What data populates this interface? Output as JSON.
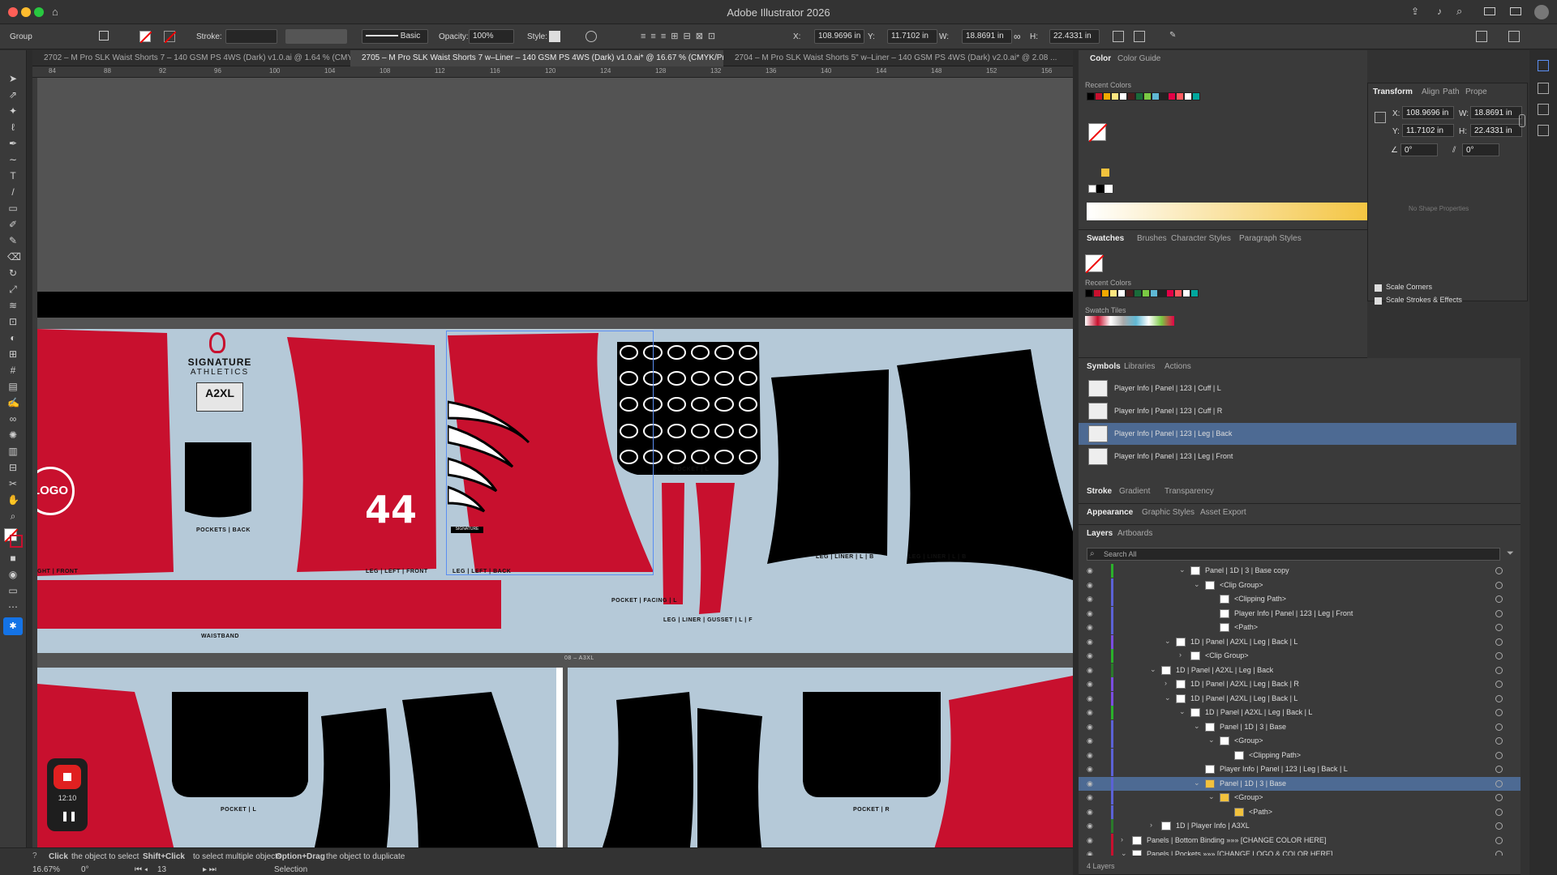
{
  "window": {
    "title": "Adobe Illustrator 2026"
  },
  "control": {
    "selection_type": "Group",
    "stroke_label": "Stroke:",
    "stroke_style": "Basic",
    "opacity_label": "Opacity:",
    "opacity_value": "100%",
    "style_label": "Style:",
    "x_label": "X:",
    "x_value": "108.9696 in",
    "y_label": "Y:",
    "y_value": "11.7102 in",
    "w_label": "W:",
    "w_value": "18.8691 in",
    "h_label": "H:",
    "h_value": "22.4331 in"
  },
  "tabs": [
    "2702 – M Pro SLK Waist Shorts 7 – 140 GSM PS 4WS (Dark) v1.0.ai @ 1.64 % (CMYK/P...",
    "2705 – M Pro SLK Waist Shorts 7 w–Liner – 140 GSM PS 4WS (Dark) v1.0.ai* @ 16.67 % (CMYK/Preview)",
    "2704 – M Pro SLK Waist Shorts 5\" w–Liner – 140 GSM PS 4WS (Dark) v2.0.ai* @ 2.08 ..."
  ],
  "ruler_ticks": [
    "84",
    "88",
    "92",
    "96",
    "100",
    "104",
    "108",
    "112",
    "116",
    "120",
    "124",
    "128",
    "132",
    "136",
    "140",
    "144",
    "148",
    "152",
    "156"
  ],
  "artwork": {
    "brand_top": "SIGNATURE",
    "brand_bottom": "ATHLETICS",
    "size_label": "A2XL",
    "logo_text": "LOGO",
    "player_number": "44",
    "signature_tag": "SIGNATURE",
    "labels": {
      "right_front": "GHT | FRONT",
      "pockets_back": "POCKETS | BACK",
      "leg_left_front": "LEG | LEFT | FRONT",
      "leg_left_back": "LEG | LEFT | BACK",
      "pocket_l": "POCKET | L",
      "pocket_facing": "POCKET | FACING | L",
      "liner_gusset": "LEG | LINER | GUSSET | L | F",
      "liner_l_b": "LEG | LINER | L | B",
      "liner_l_b2": "LEG | LINER | L | B",
      "waistband": "WAISTBAND",
      "pocket_l2": "POCKET | L",
      "pocket_r": "POCKET | R",
      "artboard_name": "08 – A3XL"
    }
  },
  "status": {
    "hint_click": "Click",
    "hint_click_text": "the object to select",
    "hint_shift": "Shift+Click",
    "hint_shift_text": "to select multiple objects",
    "hint_option": "Option+Drag",
    "hint_option_text": "the object to duplicate",
    "zoom": "16.67%",
    "rotation": "0°",
    "artboard_num": "13",
    "tool_name": "Selection",
    "timer": "12:10"
  },
  "color_panel": {
    "tabs": [
      "Color",
      "Color Guide"
    ],
    "recent_label": "Recent Colors",
    "recent": [
      "#000000",
      "#c8102e",
      "#f2a900",
      "#ffe680",
      "#ffffff",
      "#4b1e1e",
      "#1a6b3a",
      "#7ac943",
      "#5fb8d4",
      "#222222",
      "#e40046",
      "#ff5a5f",
      "#ffffff",
      "#00a79d"
    ],
    "gradient_start": "#ffffff",
    "gradient_end": "#f4c542"
  },
  "swatches_panel": {
    "tabs": [
      "Swatches",
      "Brushes",
      "Character Styles",
      "Paragraph Styles"
    ],
    "recent_label": "Recent Colors",
    "tiles_label": "Swatch Tiles"
  },
  "transform_panel": {
    "tabs": [
      "Transform",
      "Align",
      "Path",
      "Prope"
    ],
    "x_label": "X:",
    "x_value": "108.9696 in",
    "y_label": "Y:",
    "y_value": "11.7102 in",
    "w_label": "W:",
    "w_value": "18.8691 in",
    "h_label": "H:",
    "h_value": "22.4331 in",
    "angle": "0°",
    "shear": "0°",
    "no_shape": "No Shape Properties",
    "scale_corners": "Scale Corners",
    "scale_strokes": "Scale Strokes & Effects"
  },
  "symbols_panel": {
    "tabs": [
      "Symbols",
      "Libraries",
      "Actions"
    ],
    "items": [
      "Player Info | Panel | 123 | Cuff | L",
      "Player Info | Panel | 123 | Cuff | R",
      "Player Info | Panel | 123 | Leg | Back",
      "Player Info | Panel | 123 | Leg | Front"
    ]
  },
  "stroke_tabs": [
    "Stroke",
    "Gradient",
    "Transparency"
  ],
  "appearance_tabs": [
    "Appearance",
    "Graphic Styles",
    "Asset Export"
  ],
  "layers_panel": {
    "tabs": [
      "Layers",
      "Artboards"
    ],
    "search_placeholder": "Search All",
    "footer": "4 Layers",
    "rows": [
      {
        "name": "Panel | 1D | 3 | Base copy",
        "indent": 6,
        "arrow": "⌄"
      },
      {
        "name": "<Clip Group>",
        "indent": 7,
        "arrow": "⌄"
      },
      {
        "name": "<Clipping Path>",
        "indent": 8,
        "arrow": ""
      },
      {
        "name": "Player Info | Panel | 123 | Leg | Front",
        "indent": 8,
        "arrow": ""
      },
      {
        "name": "<Path>",
        "indent": 8,
        "arrow": ""
      },
      {
        "name": "1D | Panel | A2XL | Leg | Back | L",
        "indent": 5,
        "arrow": "⌄"
      },
      {
        "name": "<Clip Group>",
        "indent": 6,
        "arrow": "›"
      },
      {
        "name": "1D | Panel | A2XL | Leg | Back",
        "indent": 4,
        "arrow": "⌄"
      },
      {
        "name": "1D | Panel | A2XL | Leg | Back | R",
        "indent": 5,
        "arrow": "›"
      },
      {
        "name": "1D | Panel | A2XL | Leg | Back | L",
        "indent": 5,
        "arrow": "⌄"
      },
      {
        "name": "1D | Panel | A2XL | Leg | Back | L",
        "indent": 6,
        "arrow": "⌄"
      },
      {
        "name": "Panel | 1D | 3 | Base",
        "indent": 7,
        "arrow": "⌄"
      },
      {
        "name": "<Group>",
        "indent": 8,
        "arrow": "⌄"
      },
      {
        "name": "<Clipping Path>",
        "indent": 9,
        "arrow": ""
      },
      {
        "name": "Player Info | Panel | 123 | Leg | Back | L",
        "indent": 7,
        "arrow": ""
      },
      {
        "name": "Panel | 1D | 3 | Base",
        "indent": 7,
        "arrow": "⌄"
      },
      {
        "name": "<Group>",
        "indent": 8,
        "arrow": "⌄"
      },
      {
        "name": "<Path>",
        "indent": 9,
        "arrow": ""
      },
      {
        "name": "1D | Player Info | A3XL",
        "indent": 4,
        "arrow": "›"
      },
      {
        "name": "Panels | Bottom Binding »»» [CHANGE COLOR HERE]",
        "indent": 2,
        "arrow": "›"
      },
      {
        "name": "Panels | Pockets »»» [CHANGE LOGO & COLOR HERE]",
        "indent": 2,
        "arrow": "⌄"
      }
    ]
  }
}
